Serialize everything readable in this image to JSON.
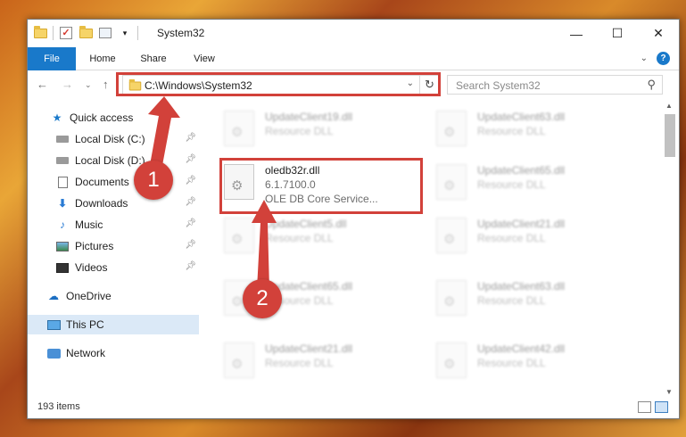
{
  "window": {
    "title": "System32"
  },
  "controls": {
    "minimize": "—",
    "maximize": "☐",
    "close": "✕"
  },
  "ribbon": {
    "tabs": [
      "File",
      "Home",
      "Share",
      "View"
    ],
    "help": "?"
  },
  "nav": {
    "address": "C:\\Windows\\System32",
    "search_placeholder": "Search System32"
  },
  "sidebar": {
    "items": [
      {
        "label": "Quick access",
        "icon": "star-icon",
        "pinned": false
      },
      {
        "label": "Local Disk (C:)",
        "icon": "disk-icon",
        "pinned": true
      },
      {
        "label": "Local Disk (D:)",
        "icon": "disk-icon",
        "pinned": true
      },
      {
        "label": "Documents",
        "icon": "documents-icon",
        "pinned": true
      },
      {
        "label": "Downloads",
        "icon": "downloads-icon",
        "pinned": true
      },
      {
        "label": "Music",
        "icon": "music-icon",
        "pinned": true
      },
      {
        "label": "Pictures",
        "icon": "pictures-icon",
        "pinned": true
      },
      {
        "label": "Videos",
        "icon": "videos-icon",
        "pinned": true
      },
      {
        "label": "OneDrive",
        "icon": "onedrive-icon",
        "pinned": false
      },
      {
        "label": "This PC",
        "icon": "this-pc-icon",
        "pinned": false,
        "selected": true
      },
      {
        "label": "Network",
        "icon": "network-icon",
        "pinned": false
      }
    ]
  },
  "files": {
    "left": [
      {
        "name": "UpdateClient19.dll",
        "type": "Resource DLL",
        "blurred": true
      },
      {
        "name": "oledb32r.dll",
        "version": "6.1.7100.0",
        "description": "OLE DB Core Service...",
        "blurred": false
      },
      {
        "name": "UpdateClient5.dll",
        "type": "Resource DLL",
        "blurred": true
      },
      {
        "name": "UpdateClient65.dll",
        "type": "Resource DLL",
        "blurred": true
      },
      {
        "name": "UpdateClient21.dll",
        "type": "Resource DLL",
        "blurred": true
      }
    ],
    "right": [
      {
        "name": "UpdateClient63.dll",
        "type": "Resource DLL",
        "blurred": true
      },
      {
        "name": "UpdateClient65.dll",
        "type": "Resource DLL",
        "blurred": true
      },
      {
        "name": "UpdateClient21.dll",
        "type": "Resource DLL",
        "blurred": true
      },
      {
        "name": "UpdateClient63.dll",
        "type": "Resource DLL",
        "blurred": true
      },
      {
        "name": "UpdateClient42.dll",
        "type": "Resource DLL",
        "blurred": true
      }
    ]
  },
  "status": {
    "item_count": "193 items"
  },
  "annotations": {
    "step1": "1",
    "step2": "2",
    "color": "#d2413a"
  }
}
